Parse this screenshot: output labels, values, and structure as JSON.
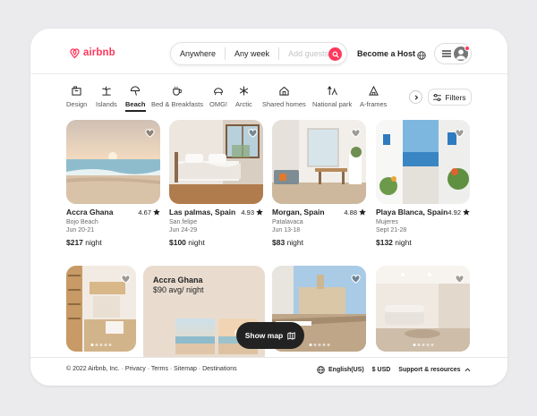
{
  "header": {
    "logo_text": "airbnb",
    "search": {
      "where": "Anywhere",
      "when": "Any week",
      "guests_placeholder": "Add guests"
    },
    "become_host": "Become a Host"
  },
  "categories": [
    {
      "label": "Design",
      "icon": "design-icon"
    },
    {
      "label": "Islands",
      "icon": "islands-icon"
    },
    {
      "label": "Beach",
      "icon": "beach-icon",
      "active": true
    },
    {
      "label": "Bed & Breakfasts",
      "icon": "bed-breakfast-icon"
    },
    {
      "label": "OMG!",
      "icon": "omg-icon"
    },
    {
      "label": "Arctic",
      "icon": "arctic-icon"
    },
    {
      "label": "Shared homes",
      "icon": "shared-homes-icon"
    },
    {
      "label": "National park",
      "icon": "national-park-icon"
    },
    {
      "label": "A-frames",
      "icon": "a-frames-icon"
    }
  ],
  "filters_label": "Filters",
  "listings": [
    {
      "title": "Accra Ghana",
      "rating": "4.67",
      "location": "Bojo Beach",
      "dates": "Jun 20-21",
      "price": "$217",
      "unit": "night"
    },
    {
      "title": "Las palmas, Spain",
      "rating": "4.93",
      "location": "San.felipe",
      "dates": "Jun 24-29",
      "price": "$100",
      "unit": "night"
    },
    {
      "title": "Morgan, Spain",
      "rating": "4.88",
      "location": "Patalavaca",
      "dates": "Jun 13-18",
      "price": "$83",
      "unit": "night"
    },
    {
      "title": "Playa Blanca, Spain",
      "rating": "4.92",
      "location": "Mujeres",
      "dates": "Sept 21-28",
      "price": "$132",
      "unit": "night"
    }
  ],
  "promo": {
    "title": "Accra Ghana",
    "price": "$90 avg/ night"
  },
  "show_map_label": "Show map",
  "footer": {
    "copyright": "© 2022 Airbnb, Inc. · Privacy · Terms · Sitemap · Destinations",
    "language": "English(US)",
    "currency": "$ USD",
    "support": "Support & resources"
  },
  "colors": {
    "brand": "#ff385c",
    "text": "#222222",
    "muted": "#6d6d6d"
  }
}
